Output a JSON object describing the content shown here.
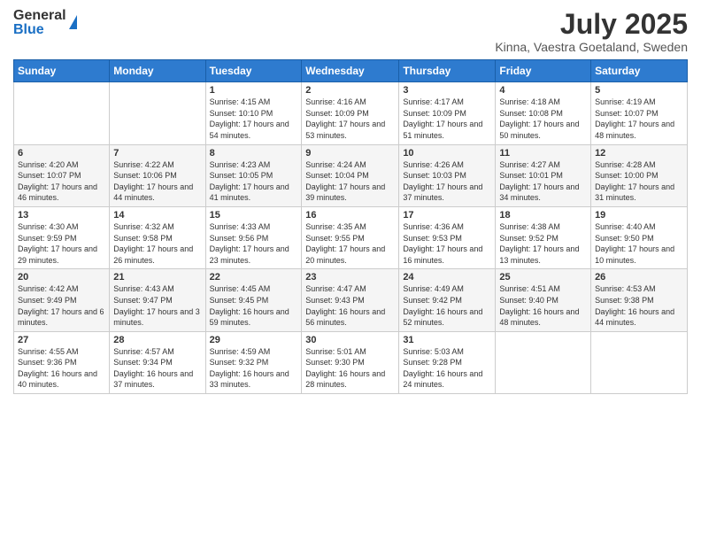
{
  "header": {
    "logo_general": "General",
    "logo_blue": "Blue",
    "month_title": "July 2025",
    "subtitle": "Kinna, Vaestra Goetaland, Sweden"
  },
  "days_of_week": [
    "Sunday",
    "Monday",
    "Tuesday",
    "Wednesday",
    "Thursday",
    "Friday",
    "Saturday"
  ],
  "weeks": [
    [
      {
        "day": "",
        "detail": ""
      },
      {
        "day": "",
        "detail": ""
      },
      {
        "day": "1",
        "detail": "Sunrise: 4:15 AM\nSunset: 10:10 PM\nDaylight: 17 hours\nand 54 minutes."
      },
      {
        "day": "2",
        "detail": "Sunrise: 4:16 AM\nSunset: 10:09 PM\nDaylight: 17 hours\nand 53 minutes."
      },
      {
        "day": "3",
        "detail": "Sunrise: 4:17 AM\nSunset: 10:09 PM\nDaylight: 17 hours\nand 51 minutes."
      },
      {
        "day": "4",
        "detail": "Sunrise: 4:18 AM\nSunset: 10:08 PM\nDaylight: 17 hours\nand 50 minutes."
      },
      {
        "day": "5",
        "detail": "Sunrise: 4:19 AM\nSunset: 10:07 PM\nDaylight: 17 hours\nand 48 minutes."
      }
    ],
    [
      {
        "day": "6",
        "detail": "Sunrise: 4:20 AM\nSunset: 10:07 PM\nDaylight: 17 hours\nand 46 minutes."
      },
      {
        "day": "7",
        "detail": "Sunrise: 4:22 AM\nSunset: 10:06 PM\nDaylight: 17 hours\nand 44 minutes."
      },
      {
        "day": "8",
        "detail": "Sunrise: 4:23 AM\nSunset: 10:05 PM\nDaylight: 17 hours\nand 41 minutes."
      },
      {
        "day": "9",
        "detail": "Sunrise: 4:24 AM\nSunset: 10:04 PM\nDaylight: 17 hours\nand 39 minutes."
      },
      {
        "day": "10",
        "detail": "Sunrise: 4:26 AM\nSunset: 10:03 PM\nDaylight: 17 hours\nand 37 minutes."
      },
      {
        "day": "11",
        "detail": "Sunrise: 4:27 AM\nSunset: 10:01 PM\nDaylight: 17 hours\nand 34 minutes."
      },
      {
        "day": "12",
        "detail": "Sunrise: 4:28 AM\nSunset: 10:00 PM\nDaylight: 17 hours\nand 31 minutes."
      }
    ],
    [
      {
        "day": "13",
        "detail": "Sunrise: 4:30 AM\nSunset: 9:59 PM\nDaylight: 17 hours\nand 29 minutes."
      },
      {
        "day": "14",
        "detail": "Sunrise: 4:32 AM\nSunset: 9:58 PM\nDaylight: 17 hours\nand 26 minutes."
      },
      {
        "day": "15",
        "detail": "Sunrise: 4:33 AM\nSunset: 9:56 PM\nDaylight: 17 hours\nand 23 minutes."
      },
      {
        "day": "16",
        "detail": "Sunrise: 4:35 AM\nSunset: 9:55 PM\nDaylight: 17 hours\nand 20 minutes."
      },
      {
        "day": "17",
        "detail": "Sunrise: 4:36 AM\nSunset: 9:53 PM\nDaylight: 17 hours\nand 16 minutes."
      },
      {
        "day": "18",
        "detail": "Sunrise: 4:38 AM\nSunset: 9:52 PM\nDaylight: 17 hours\nand 13 minutes."
      },
      {
        "day": "19",
        "detail": "Sunrise: 4:40 AM\nSunset: 9:50 PM\nDaylight: 17 hours\nand 10 minutes."
      }
    ],
    [
      {
        "day": "20",
        "detail": "Sunrise: 4:42 AM\nSunset: 9:49 PM\nDaylight: 17 hours\nand 6 minutes."
      },
      {
        "day": "21",
        "detail": "Sunrise: 4:43 AM\nSunset: 9:47 PM\nDaylight: 17 hours\nand 3 minutes."
      },
      {
        "day": "22",
        "detail": "Sunrise: 4:45 AM\nSunset: 9:45 PM\nDaylight: 16 hours\nand 59 minutes."
      },
      {
        "day": "23",
        "detail": "Sunrise: 4:47 AM\nSunset: 9:43 PM\nDaylight: 16 hours\nand 56 minutes."
      },
      {
        "day": "24",
        "detail": "Sunrise: 4:49 AM\nSunset: 9:42 PM\nDaylight: 16 hours\nand 52 minutes."
      },
      {
        "day": "25",
        "detail": "Sunrise: 4:51 AM\nSunset: 9:40 PM\nDaylight: 16 hours\nand 48 minutes."
      },
      {
        "day": "26",
        "detail": "Sunrise: 4:53 AM\nSunset: 9:38 PM\nDaylight: 16 hours\nand 44 minutes."
      }
    ],
    [
      {
        "day": "27",
        "detail": "Sunrise: 4:55 AM\nSunset: 9:36 PM\nDaylight: 16 hours\nand 40 minutes."
      },
      {
        "day": "28",
        "detail": "Sunrise: 4:57 AM\nSunset: 9:34 PM\nDaylight: 16 hours\nand 37 minutes."
      },
      {
        "day": "29",
        "detail": "Sunrise: 4:59 AM\nSunset: 9:32 PM\nDaylight: 16 hours\nand 33 minutes."
      },
      {
        "day": "30",
        "detail": "Sunrise: 5:01 AM\nSunset: 9:30 PM\nDaylight: 16 hours\nand 28 minutes."
      },
      {
        "day": "31",
        "detail": "Sunrise: 5:03 AM\nSunset: 9:28 PM\nDaylight: 16 hours\nand 24 minutes."
      },
      {
        "day": "",
        "detail": ""
      },
      {
        "day": "",
        "detail": ""
      }
    ]
  ]
}
